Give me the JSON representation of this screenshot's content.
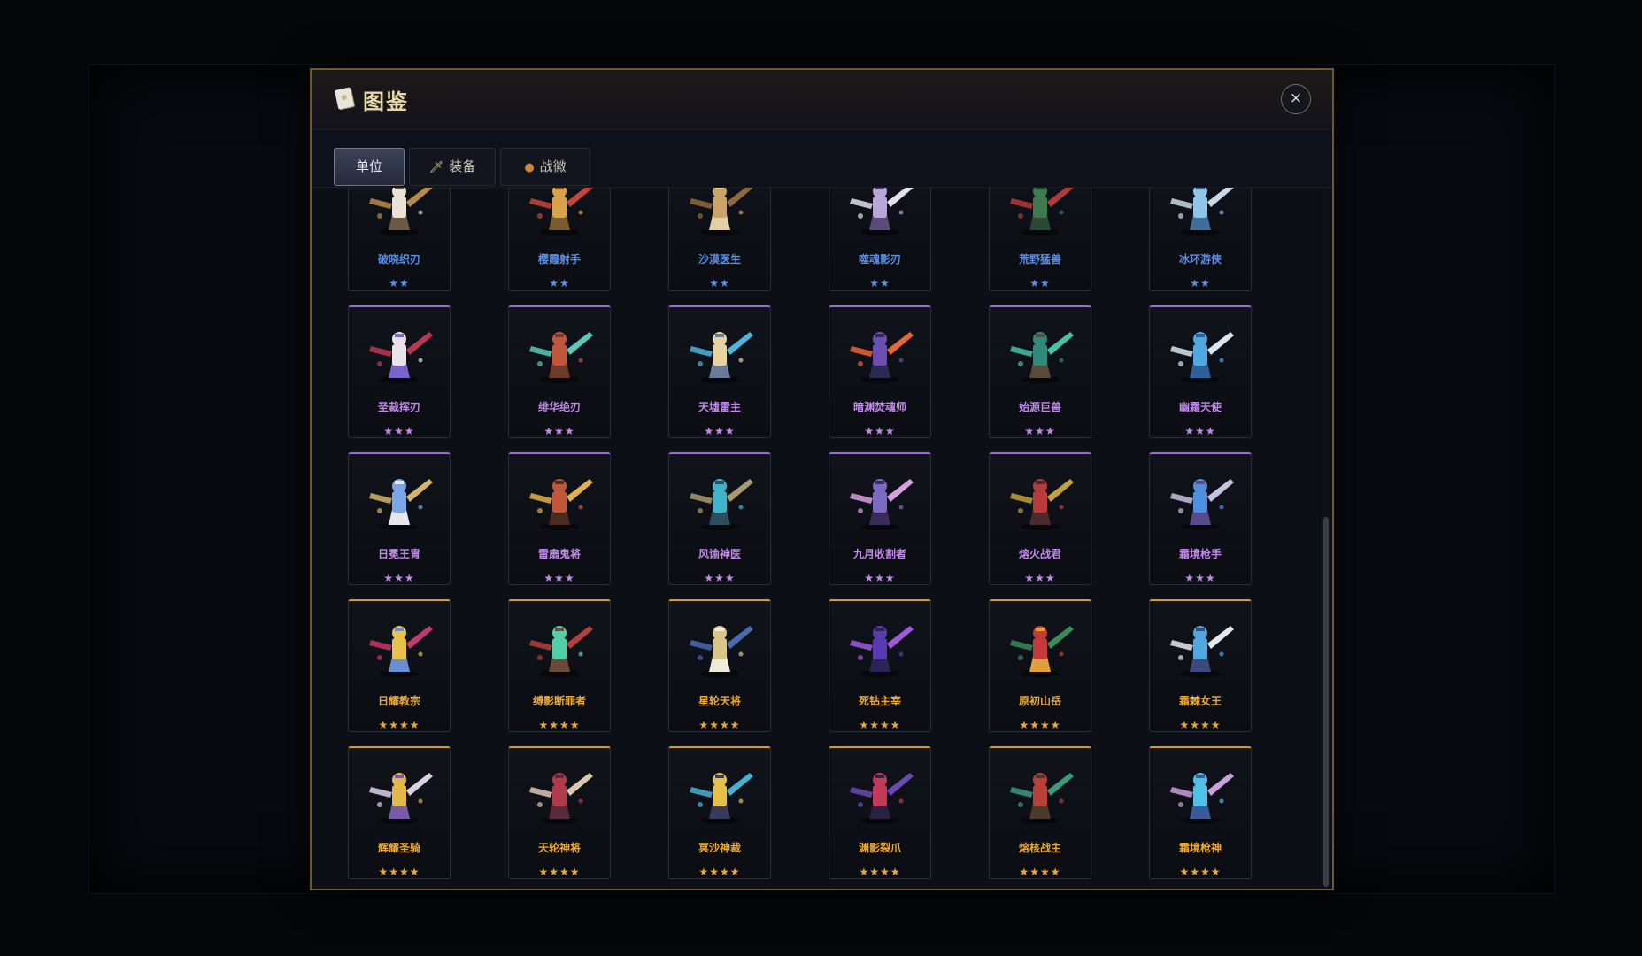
{
  "window": {
    "title": "图鉴",
    "close_label": "×"
  },
  "tabs": [
    {
      "label": "单位",
      "icon": "",
      "active": true
    },
    {
      "label": "装备",
      "icon": "sword-icon",
      "active": false
    },
    {
      "label": "战徽",
      "icon": "medal-icon",
      "active": false
    }
  ],
  "rarity_colors": {
    "2": "#5c8fe6",
    "3": "#c08ae8",
    "4": "#e9a93a"
  },
  "units": [
    {
      "name": "破晓织刃",
      "stars": "★★",
      "rarity": 2,
      "palette": [
        "#e8e3d6",
        "#b78a4a",
        "#6a5a44"
      ]
    },
    {
      "name": "樱霞射手",
      "stars": "★★",
      "rarity": 2,
      "palette": [
        "#d9a24a",
        "#c2463c",
        "#7c5a30"
      ]
    },
    {
      "name": "沙漠医生",
      "stars": "★★",
      "rarity": 2,
      "palette": [
        "#c9a36a",
        "#8b6b3e",
        "#e3d0a5"
      ]
    },
    {
      "name": "噬魂影刃",
      "stars": "★★",
      "rarity": 2,
      "palette": [
        "#b9a5d8",
        "#e3dff0",
        "#5b4a7a"
      ]
    },
    {
      "name": "荒野猛兽",
      "stars": "★★",
      "rarity": 2,
      "palette": [
        "#3f7a4f",
        "#b23a3a",
        "#2b4a36"
      ]
    },
    {
      "name": "冰环游侠",
      "stars": "★★",
      "rarity": 2,
      "palette": [
        "#8fc6e8",
        "#c9d8e6",
        "#3d6f9a"
      ]
    },
    {
      "name": "圣裁挥刃",
      "stars": "★★★",
      "rarity": 3,
      "palette": [
        "#e9e2ea",
        "#b73a52",
        "#7a63c9"
      ]
    },
    {
      "name": "绯华绝刃",
      "stars": "★★★",
      "rarity": 3,
      "palette": [
        "#c2563a",
        "#5cc9b8",
        "#6e3a2a"
      ]
    },
    {
      "name": "天墟雷主",
      "stars": "★★★",
      "rarity": 3,
      "palette": [
        "#e6d3a0",
        "#4fb4d8",
        "#6a7a9a"
      ]
    },
    {
      "name": "暗渊焚魂师",
      "stars": "★★★",
      "rarity": 3,
      "palette": [
        "#6b4fb0",
        "#e5673a",
        "#2b2a55"
      ]
    },
    {
      "name": "始源巨兽",
      "stars": "★★★",
      "rarity": 3,
      "palette": [
        "#2f8a7a",
        "#47c2a8",
        "#5b4a3a"
      ]
    },
    {
      "name": "幽霜天使",
      "stars": "★★★",
      "rarity": 3,
      "palette": [
        "#4fa8e0",
        "#d9e6f2",
        "#2d5f9a"
      ]
    },
    {
      "name": "日冕王胄",
      "stars": "★★★",
      "rarity": 3,
      "palette": [
        "#7aa6e6",
        "#d4b46a",
        "#e6e6f0"
      ]
    },
    {
      "name": "雷扇鬼将",
      "stars": "★★★",
      "rarity": 3,
      "palette": [
        "#c2563a",
        "#e2b048",
        "#4a2b1e"
      ]
    },
    {
      "name": "风谕神医",
      "stars": "★★★",
      "rarity": 3,
      "palette": [
        "#3fb4c9",
        "#a89a72",
        "#2b4f5a"
      ]
    },
    {
      "name": "九月收割者",
      "stars": "★★★",
      "rarity": 3,
      "palette": [
        "#7a6ac2",
        "#d9a0e0",
        "#3a2b5a"
      ]
    },
    {
      "name": "熔火战君",
      "stars": "★★★",
      "rarity": 3,
      "palette": [
        "#b83a3a",
        "#c2a03a",
        "#4a2a2a"
      ]
    },
    {
      "name": "霜境枪手",
      "stars": "★★★",
      "rarity": 3,
      "palette": [
        "#4f8fe0",
        "#c9c0e0",
        "#5a4a8a"
      ]
    },
    {
      "name": "日耀教宗",
      "stars": "★★★★",
      "rarity": 4,
      "palette": [
        "#e6c34a",
        "#c23a6a",
        "#6a8fd0"
      ]
    },
    {
      "name": "缚影断罪者",
      "stars": "★★★★",
      "rarity": 4,
      "palette": [
        "#4fd0a8",
        "#b2403a",
        "#6a4a3a"
      ]
    },
    {
      "name": "星轮天将",
      "stars": "★★★★",
      "rarity": 4,
      "palette": [
        "#d9c68a",
        "#4a6ab0",
        "#f0ead8"
      ]
    },
    {
      "name": "死钻主宰",
      "stars": "★★★★",
      "rarity": 4,
      "palette": [
        "#5a3ab0",
        "#a05ad9",
        "#2b2255"
      ]
    },
    {
      "name": "原初山岳",
      "stars": "★★★★",
      "rarity": 4,
      "palette": [
        "#c23a3a",
        "#3a8a5a",
        "#e2a03a"
      ]
    },
    {
      "name": "霜棘女王",
      "stars": "★★★★",
      "rarity": 4,
      "palette": [
        "#4fa8e0",
        "#e6e6f0",
        "#3a4a7a"
      ]
    },
    {
      "name": "辉耀圣骑",
      "stars": "★★★★",
      "rarity": 4,
      "palette": [
        "#e2b84a",
        "#d9d0e6",
        "#7a5aa8"
      ]
    },
    {
      "name": "天轮神将",
      "stars": "★★★★",
      "rarity": 4,
      "palette": [
        "#b03a4a",
        "#d9c9b0",
        "#5a2a3a"
      ]
    },
    {
      "name": "冥沙神裁",
      "stars": "★★★★",
      "rarity": 4,
      "palette": [
        "#e2c04a",
        "#4ab0d0",
        "#3a3a5a"
      ]
    },
    {
      "name": "渊影裂爪",
      "stars": "★★★★",
      "rarity": 4,
      "palette": [
        "#c23a5a",
        "#6a4ab0",
        "#2a2240"
      ]
    },
    {
      "name": "熔核战主",
      "stars": "★★★★",
      "rarity": 4,
      "palette": [
        "#b8403a",
        "#3a9a7a",
        "#4a3a2a"
      ]
    },
    {
      "name": "霜境枪神",
      "stars": "★★★★",
      "rarity": 4,
      "palette": [
        "#4fc0e8",
        "#c9a0d9",
        "#3a5a9a"
      ]
    }
  ]
}
